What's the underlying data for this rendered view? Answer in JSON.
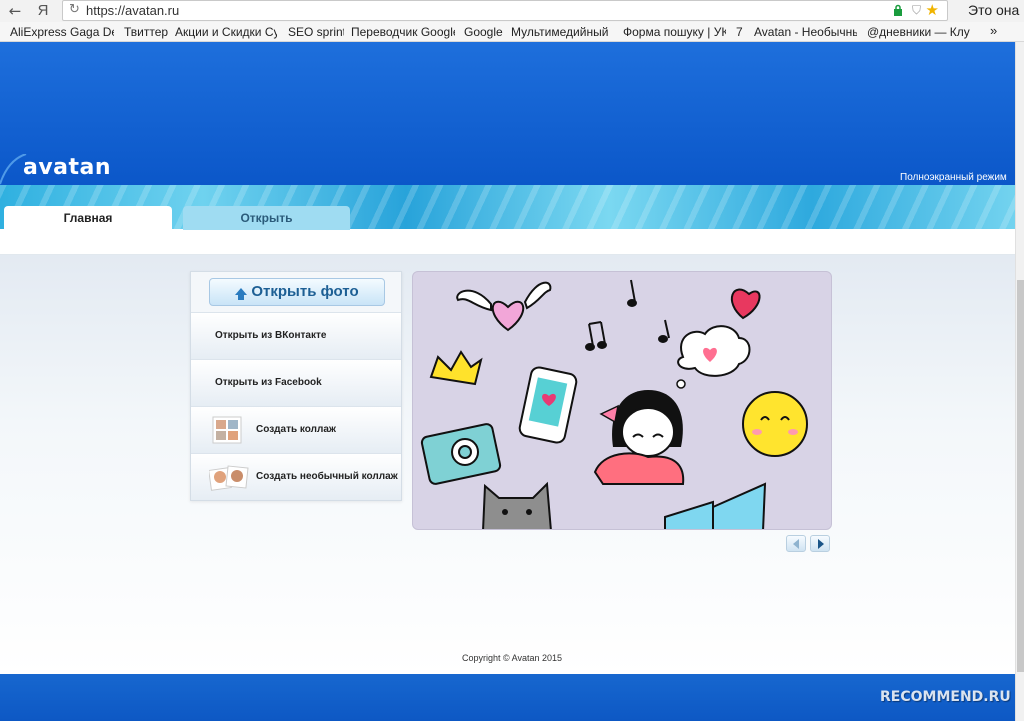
{
  "browser": {
    "url": "https://avatan.ru",
    "profile_name": "Это она",
    "back_glyph": "←",
    "yandex_glyph": "Я",
    "reload_glyph": "↻",
    "more_glyph": "»",
    "bookmarks": [
      "AliExpress Gaga Deal",
      "Твиттер",
      "Акции и Скидки Суп",
      "SEO sprint",
      "Переводчик Google",
      "Google",
      "Мультимедийный ф",
      "Форма пошуку | УКР",
      "7",
      "Avatan - Необычны",
      "@дневники — Клуб"
    ]
  },
  "site": {
    "logo": "avatan",
    "fullscreen_label": "Полноэкранный режим",
    "tabs": [
      {
        "label": "Главная",
        "active": true
      },
      {
        "label": "Открыть",
        "active": false
      }
    ],
    "menu": {
      "open_photo": "Открыть фото",
      "items": [
        {
          "label": "Открыть из ВКонтакте"
        },
        {
          "label": "Открыть из Facebook"
        },
        {
          "label": "Создать коллаж",
          "icon": "collage-icon"
        },
        {
          "label": "Создать необычный коллаж",
          "icon": "unusual-collage-icon"
        }
      ]
    },
    "copyright": "Copyright © Avatan 2015",
    "watermark": "RECOMMEND.RU"
  },
  "colors": {
    "header_blue": "#0b57c9",
    "water_cyan": "#2fb0e0",
    "tab_inactive": "#9fdcf2",
    "slide_bg": "#d8d3e6"
  }
}
